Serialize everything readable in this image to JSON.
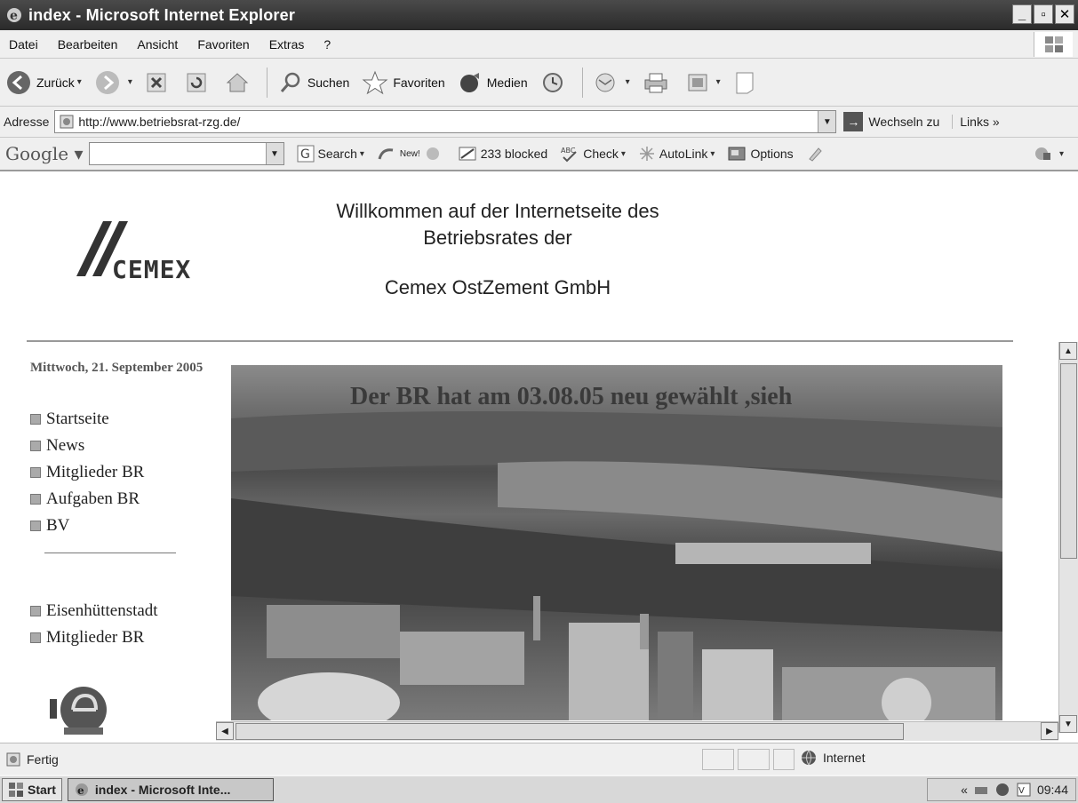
{
  "window": {
    "title": "index - Microsoft Internet Explorer"
  },
  "menu": [
    "Datei",
    "Bearbeiten",
    "Ansicht",
    "Favoriten",
    "Extras",
    "?"
  ],
  "toolbar": {
    "back": "Zurück",
    "search": "Suchen",
    "favorites": "Favoriten",
    "media": "Medien"
  },
  "address": {
    "label": "Adresse",
    "url": "http://www.betriebsrat-rzg.de/",
    "go": "Wechseln zu",
    "links": "Links"
  },
  "google": {
    "logo": "Google",
    "search": "Search",
    "new": "New!",
    "blocked": "233 blocked",
    "check": "Check",
    "autolink": "AutoLink",
    "options": "Options"
  },
  "page": {
    "logo_text": "CEMEX",
    "welcome_line1": "Willkommen auf der Internetseite des",
    "welcome_line2": "Betriebsrates der",
    "company": "Cemex OstZement GmbH",
    "date": "Mittwoch, 21. September 2005",
    "nav": [
      "Startseite",
      "News",
      "Mitglieder BR",
      "Aufgaben BR",
      "BV"
    ],
    "nav2": [
      "Eisenhüttenstadt",
      "Mitglieder BR"
    ],
    "marquee": "Der BR hat am 03.08.05 neu gewählt ,sieh"
  },
  "status": {
    "text": "Fertig",
    "zone": "Internet"
  },
  "taskbar": {
    "start": "Start",
    "task": "index - Microsoft Inte...",
    "time": "09:44"
  }
}
